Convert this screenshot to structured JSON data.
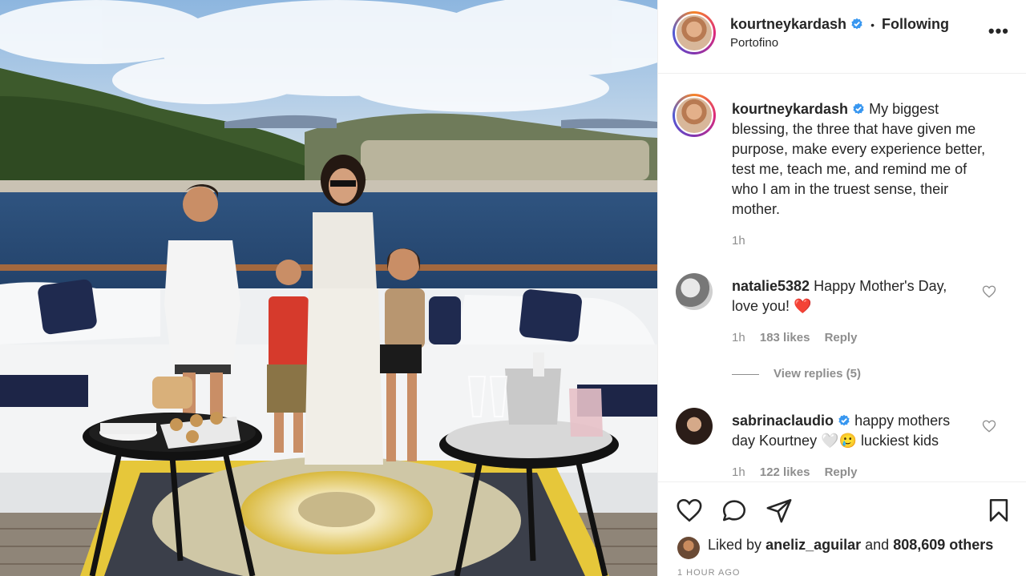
{
  "post": {
    "username": "kourtneykardash",
    "follow_status": "Following",
    "separator": "•",
    "location": "Portofino",
    "more_label": "•••"
  },
  "caption": {
    "username": "kourtneykardash",
    "text": "My biggest blessing, the three that have given me purpose, make every experience better, test me, teach me, and remind me of who I am in the truest sense, their mother.",
    "time": "1h"
  },
  "comments": [
    {
      "username": "natalie5382",
      "text": "Happy Mother's Day, love you!",
      "emoji": "❤️",
      "time": "1h",
      "likes": "183 likes",
      "reply_label": "Reply"
    },
    {
      "username": "sabrinaclaudio",
      "text_before": "happy mothers day Kourtney",
      "emoji": "🤍🥲",
      "text_after": "luckiest kids",
      "time": "1h",
      "likes": "122 likes",
      "reply_label": "Reply"
    }
  ],
  "view_replies": "View replies (5)",
  "likes_summary": {
    "prefix": "Liked by",
    "user": "aneliz_aguilar",
    "middle": "and",
    "count": "808,609 others"
  },
  "timestamp": "1 HOUR AGO",
  "icons": {
    "verified": "verified-badge-icon",
    "more": "more-options-icon",
    "like": "heart-icon",
    "comment": "comment-icon",
    "share": "share-icon",
    "save": "bookmark-icon"
  },
  "colors": {
    "verified_blue": "#3897f0",
    "text": "#262626",
    "muted": "#8e8e8e",
    "heart_red": "#ed4956"
  }
}
